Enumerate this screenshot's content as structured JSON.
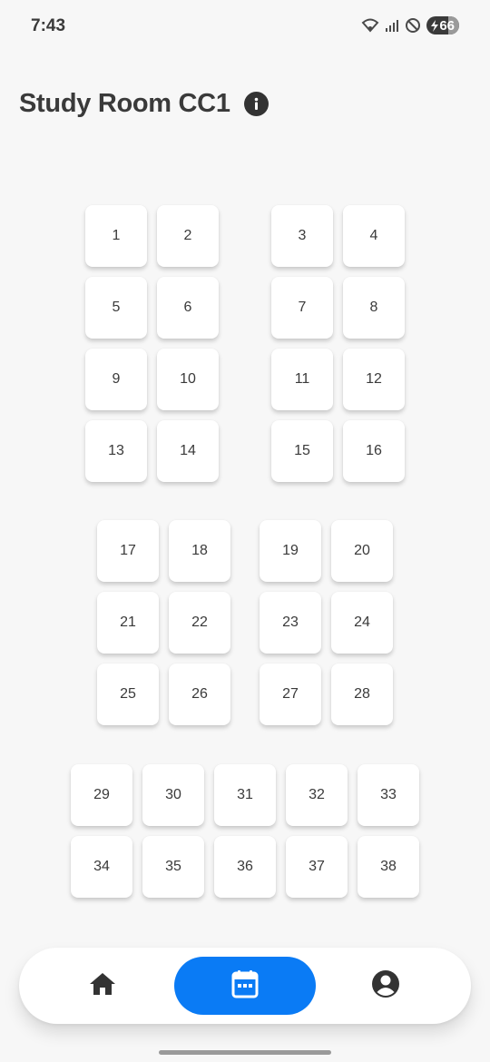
{
  "status_bar": {
    "time": "7:43",
    "battery": "66",
    "icons": [
      "wifi-icon",
      "signal-icon",
      "do-not-disturb-icon",
      "battery-charging-icon"
    ]
  },
  "header": {
    "title": "Study Room CC1",
    "info_icon": "info-icon"
  },
  "seats": [
    "1",
    "2",
    "3",
    "4",
    "5",
    "6",
    "7",
    "8",
    "9",
    "10",
    "11",
    "12",
    "13",
    "14",
    "15",
    "16",
    "17",
    "18",
    "19",
    "20",
    "21",
    "22",
    "23",
    "24",
    "25",
    "26",
    "27",
    "28",
    "29",
    "30",
    "31",
    "32",
    "33",
    "34",
    "35",
    "36",
    "37",
    "38"
  ],
  "bottom_nav": {
    "items": [
      {
        "icon": "home-icon",
        "active": false
      },
      {
        "icon": "calendar-icon",
        "active": true
      },
      {
        "icon": "profile-icon",
        "active": false
      }
    ],
    "accent_color": "#0a7bf5"
  }
}
